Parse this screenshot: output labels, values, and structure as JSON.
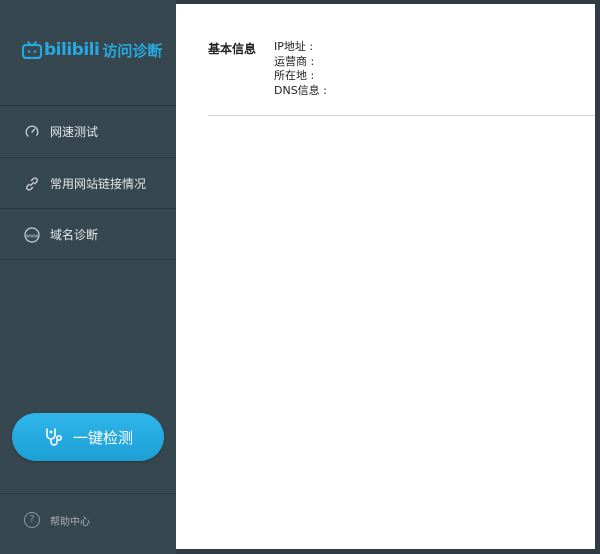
{
  "brand": {
    "bili": "bilibili",
    "title": "访问诊断"
  },
  "nav": {
    "items": [
      {
        "label": "网速测试",
        "icon": "speed-gauge-icon"
      },
      {
        "label": "常用网站链接情况",
        "icon": "link-icon"
      },
      {
        "label": "域名诊断",
        "icon": "www-icon"
      }
    ]
  },
  "action": {
    "check_label": "一键检测",
    "icon": "stethoscope-icon"
  },
  "help": {
    "label": "帮助中心",
    "icon_glyph": "?"
  },
  "info": {
    "title": "基本信息",
    "rows": [
      {
        "label": "IP地址 :",
        "value": ""
      },
      {
        "label": "运营商 :",
        "value": ""
      },
      {
        "label": "所在地 :",
        "value": ""
      },
      {
        "label": "DNS信息 :",
        "value": ""
      }
    ]
  },
  "colors": {
    "sidebar_bg": "#37474f",
    "accent": "#27a8df",
    "button_gradient_top": "#2fb6ea",
    "button_gradient_bottom": "#1c9fd6"
  }
}
